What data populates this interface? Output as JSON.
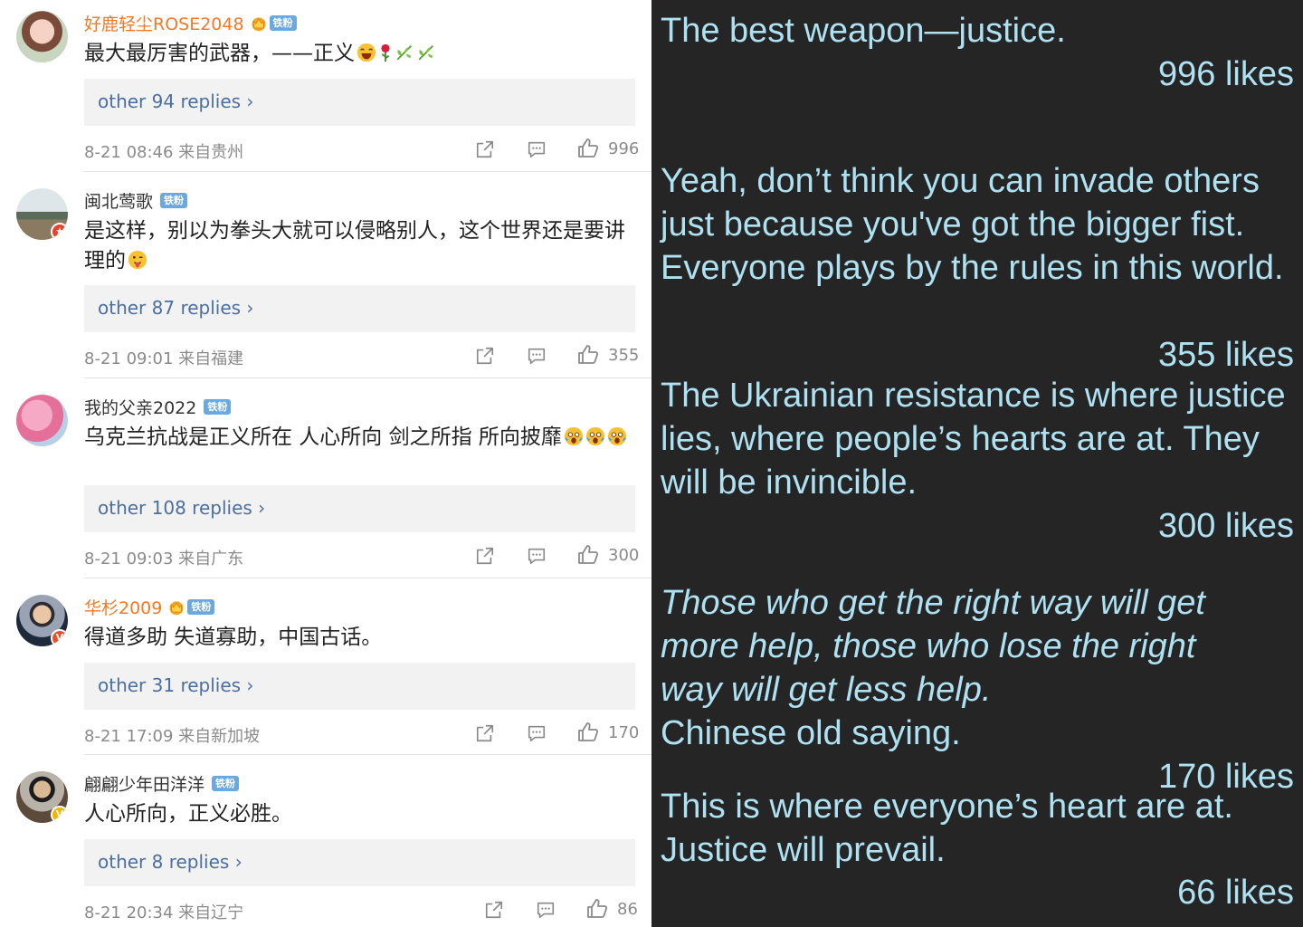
{
  "comments": [
    {
      "username": "好鹿轻尘ROSE2048",
      "fan_badge": "铁粉",
      "text": "最大最厉害的武器，——正义",
      "replies": "other 94 replies ›",
      "time_location": "8-21 08:46  来自贵州",
      "likes": "996"
    },
    {
      "username": "闽北莺歌",
      "fan_badge": "铁粉",
      "text": "是这样，别以为拳头大就可以侵略别人，这个世界还是要讲理的",
      "replies": "other 87 replies ›",
      "time_location": "8-21 09:01  来自福建",
      "likes": "355"
    },
    {
      "username": "我的父亲2022",
      "fan_badge": "铁粉",
      "text": "乌克兰抗战是正义所在 人心所向 剑之所指 所向披靡",
      "replies": "other 108 replies ›",
      "time_location": "8-21 09:03  来自广东",
      "likes": "300"
    },
    {
      "username": "华杉2009",
      "fan_badge": "铁粉",
      "text": "得道多助 失道寡助，中国古话。",
      "replies": "other 31 replies ›",
      "time_location": "8-21 17:09  来自新加坡",
      "likes": "170"
    },
    {
      "username": "翩翩少年田洋洋",
      "fan_badge": "铁粉",
      "text": "人心所向，正义必胜。",
      "replies": "other 8 replies ›",
      "time_location": "8-21 20:34  来自辽宁",
      "likes": "86"
    }
  ],
  "translations": [
    {
      "text": "The best weapon—justice.",
      "likes": "996 likes"
    },
    {
      "text": "Yeah, don’t think you can invade others just because you've got the bigger fist. Everyone plays by the rules in this world.",
      "likes": "355 likes"
    },
    {
      "text": "The Ukrainian resistance is where justice lies, where people’s hearts are at. They will be invincible.",
      "likes": "300 likes"
    },
    {
      "text_italic": "Those who get the right way will get more help, those who lose the right way will get less help.",
      "text": "Chinese old saying.",
      "likes": "170 likes"
    },
    {
      "text": "This is where everyone’s heart are at. Justice will prevail.",
      "likes": "66 likes"
    }
  ],
  "colors": {
    "username_highlight": "#f47925",
    "reply_link": "#4a6fa0",
    "fan_badge": "#6aa8e0",
    "translation_text": "#aee1f2",
    "translation_bg": "#252525"
  }
}
